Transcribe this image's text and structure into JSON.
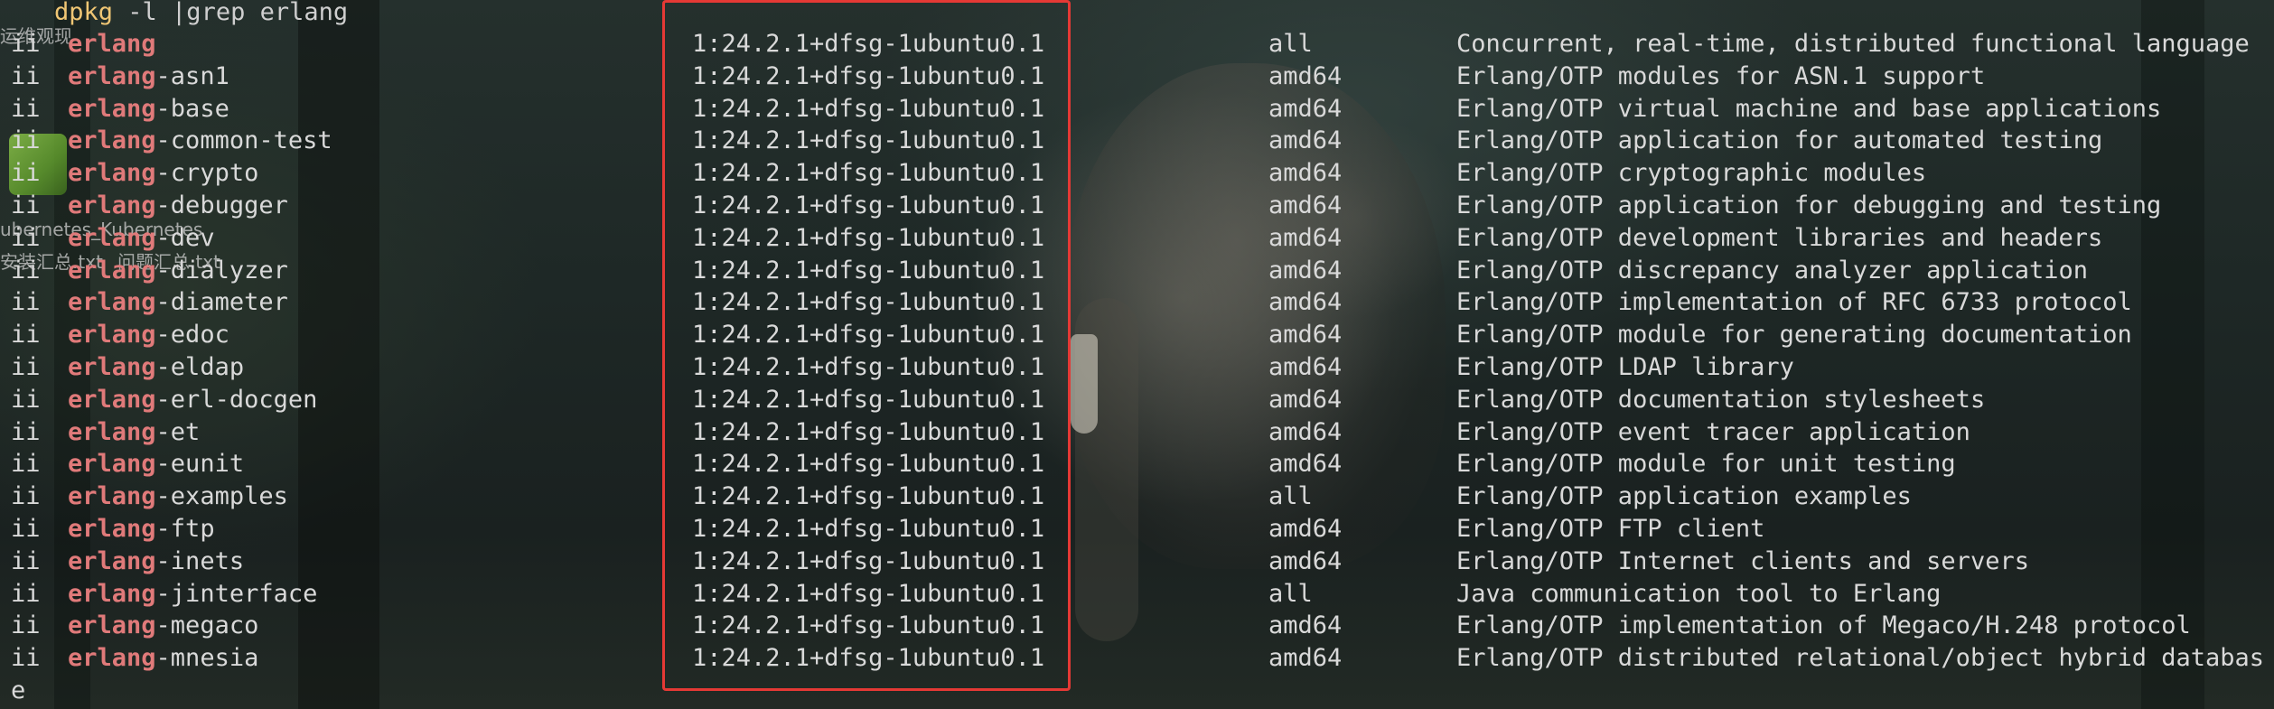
{
  "terminal": {
    "command": {
      "name": "dpkg",
      "args": " -l |grep erlang"
    },
    "package_prefix": "erlang",
    "rows": [
      {
        "status": "ii",
        "suffix": "",
        "version": "1:24.2.1+dfsg-1ubuntu0.1",
        "arch": "all",
        "desc": "Concurrent, real-time, distributed functional language"
      },
      {
        "status": "ii",
        "suffix": "-asn1",
        "version": "1:24.2.1+dfsg-1ubuntu0.1",
        "arch": "amd64",
        "desc": "Erlang/OTP modules for ASN.1 support"
      },
      {
        "status": "ii",
        "suffix": "-base",
        "version": "1:24.2.1+dfsg-1ubuntu0.1",
        "arch": "amd64",
        "desc": "Erlang/OTP virtual machine and base applications"
      },
      {
        "status": "ii",
        "suffix": "-common-test",
        "version": "1:24.2.1+dfsg-1ubuntu0.1",
        "arch": "amd64",
        "desc": "Erlang/OTP application for automated testing"
      },
      {
        "status": "ii",
        "suffix": "-crypto",
        "version": "1:24.2.1+dfsg-1ubuntu0.1",
        "arch": "amd64",
        "desc": "Erlang/OTP cryptographic modules"
      },
      {
        "status": "ii",
        "suffix": "-debugger",
        "version": "1:24.2.1+dfsg-1ubuntu0.1",
        "arch": "amd64",
        "desc": "Erlang/OTP application for debugging and testing"
      },
      {
        "status": "ii",
        "suffix": "-dev",
        "version": "1:24.2.1+dfsg-1ubuntu0.1",
        "arch": "amd64",
        "desc": "Erlang/OTP development libraries and headers"
      },
      {
        "status": "ii",
        "suffix": "-dialyzer",
        "version": "1:24.2.1+dfsg-1ubuntu0.1",
        "arch": "amd64",
        "desc": "Erlang/OTP discrepancy analyzer application"
      },
      {
        "status": "ii",
        "suffix": "-diameter",
        "version": "1:24.2.1+dfsg-1ubuntu0.1",
        "arch": "amd64",
        "desc": "Erlang/OTP implementation of RFC 6733 protocol"
      },
      {
        "status": "ii",
        "suffix": "-edoc",
        "version": "1:24.2.1+dfsg-1ubuntu0.1",
        "arch": "amd64",
        "desc": "Erlang/OTP module for generating documentation"
      },
      {
        "status": "ii",
        "suffix": "-eldap",
        "version": "1:24.2.1+dfsg-1ubuntu0.1",
        "arch": "amd64",
        "desc": "Erlang/OTP LDAP library"
      },
      {
        "status": "ii",
        "suffix": "-erl-docgen",
        "version": "1:24.2.1+dfsg-1ubuntu0.1",
        "arch": "amd64",
        "desc": "Erlang/OTP documentation stylesheets"
      },
      {
        "status": "ii",
        "suffix": "-et",
        "version": "1:24.2.1+dfsg-1ubuntu0.1",
        "arch": "amd64",
        "desc": "Erlang/OTP event tracer application"
      },
      {
        "status": "ii",
        "suffix": "-eunit",
        "version": "1:24.2.1+dfsg-1ubuntu0.1",
        "arch": "amd64",
        "desc": "Erlang/OTP module for unit testing"
      },
      {
        "status": "ii",
        "suffix": "-examples",
        "version": "1:24.2.1+dfsg-1ubuntu0.1",
        "arch": "all",
        "desc": "Erlang/OTP application examples"
      },
      {
        "status": "ii",
        "suffix": "-ftp",
        "version": "1:24.2.1+dfsg-1ubuntu0.1",
        "arch": "amd64",
        "desc": "Erlang/OTP FTP client"
      },
      {
        "status": "ii",
        "suffix": "-inets",
        "version": "1:24.2.1+dfsg-1ubuntu0.1",
        "arch": "amd64",
        "desc": "Erlang/OTP Internet clients and servers"
      },
      {
        "status": "ii",
        "suffix": "-jinterface",
        "version": "1:24.2.1+dfsg-1ubuntu0.1",
        "arch": "all",
        "desc": "Java communication tool to Erlang"
      },
      {
        "status": "ii",
        "suffix": "-megaco",
        "version": "1:24.2.1+dfsg-1ubuntu0.1",
        "arch": "amd64",
        "desc": "Erlang/OTP implementation of Megaco/H.248 protocol"
      },
      {
        "status": "ii",
        "suffix": "-mnesia",
        "version": "1:24.2.1+dfsg-1ubuntu0.1",
        "arch": "amd64",
        "desc": "Erlang/OTP distributed relational/object hybrid databas"
      }
    ],
    "wrap_remainder": "e"
  },
  "desktop_overlay": {
    "lines": [
      "运维观现",
      "ubernetes_Kubernetes",
      "安装汇总.txt",
      "问题汇总.txt"
    ]
  },
  "colors": {
    "highlight_border": "#e53935",
    "package_prefix": "#e07a7a",
    "text": "#d9d9d9"
  }
}
